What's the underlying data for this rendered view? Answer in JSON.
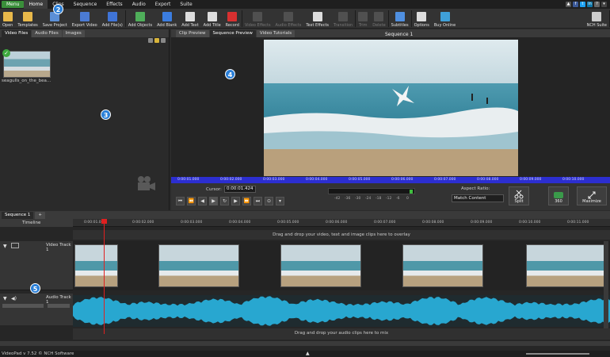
{
  "menubar": {
    "menu_label": "Menu",
    "tabs": [
      "Home",
      "Clips",
      "Sequence",
      "Effects",
      "Audio",
      "Export",
      "Suite"
    ],
    "active_tab": "Home"
  },
  "toolbar": {
    "items": [
      {
        "label": "Open",
        "icon": "folder-open-icon",
        "color": "#e8b84a",
        "enabled": true
      },
      {
        "label": "Templates",
        "icon": "folder-icon",
        "color": "#e8b84a",
        "enabled": true
      },
      {
        "label": "Save Project",
        "icon": "save-icon",
        "color": "#5b8fd6",
        "enabled": true
      },
      {
        "label": "Export Video",
        "icon": "export-icon",
        "color": "#4b7bd4",
        "enabled": true
      },
      {
        "label": "Add File(s)",
        "icon": "add-file-icon",
        "color": "#3f74d8",
        "enabled": true
      },
      {
        "label": "Add Objects",
        "icon": "add-objects-icon",
        "color": "#4fae5a",
        "enabled": true
      },
      {
        "label": "Add Blank",
        "icon": "add-blank-icon",
        "color": "#3b7de0",
        "enabled": true
      },
      {
        "label": "Add Text",
        "icon": "text-icon",
        "color": "#dddddd",
        "enabled": true
      },
      {
        "label": "Add Title",
        "icon": "title-icon",
        "color": "#dddddd",
        "enabled": true
      },
      {
        "label": "Record",
        "icon": "record-icon",
        "color": "#d83030",
        "enabled": true
      },
      {
        "label": "Video Effects",
        "icon": "video-effects-icon",
        "color": "#888888",
        "enabled": false
      },
      {
        "label": "Audio Effects",
        "icon": "audio-effects-icon",
        "color": "#888888",
        "enabled": false
      },
      {
        "label": "Text Effects",
        "icon": "text-effects-icon",
        "color": "#dddddd",
        "enabled": true
      },
      {
        "label": "Transition",
        "icon": "transition-icon",
        "color": "#888888",
        "enabled": false
      },
      {
        "label": "Trim",
        "icon": "trim-icon",
        "color": "#888888",
        "enabled": false
      },
      {
        "label": "Delete",
        "icon": "delete-icon",
        "color": "#888888",
        "enabled": false
      },
      {
        "label": "Subtitles",
        "icon": "subtitles-icon",
        "color": "#4f8fe0",
        "enabled": true
      },
      {
        "label": "Options",
        "icon": "options-icon",
        "color": "#dddddd",
        "enabled": true
      },
      {
        "label": "Buy Online",
        "icon": "buy-online-icon",
        "color": "#3fa0d8",
        "enabled": true
      },
      {
        "label": "NCH Suite",
        "icon": "nch-suite-icon",
        "color": "#cccccc",
        "enabled": true
      }
    ]
  },
  "bins": {
    "tabs": [
      "Video Files",
      "Audio Files",
      "Images"
    ],
    "active_tab": "Video Files",
    "clip_name": "seagulls_on_the_bea..."
  },
  "preview": {
    "tabs": [
      "Clip Preview",
      "Sequence Preview",
      "Video Tutorials"
    ],
    "active_tab": "Sequence Preview",
    "title": "Sequence 1",
    "ruler_ticks": [
      "0:00:01.000",
      "0:00:02.000",
      "0:00:03.000",
      "0:00:04.000",
      "0:00:05.000",
      "0:00:06.000",
      "0:00:07.000",
      "0:00:08.000",
      "0:00:09.000",
      "0:00:10.000"
    ],
    "cursor_label": "Cursor:",
    "cursor_time": "0:00:01.424",
    "meter_labels": [
      "-42",
      "-36",
      "-30",
      "-24",
      "-18",
      "-12",
      "-6",
      "0"
    ],
    "aspect_label": "Aspect Ratio:",
    "aspect_value": "Match Content",
    "split_label": "Split",
    "view_label": "360",
    "maximize_label": "Maximize"
  },
  "timeline": {
    "sequence_tab": "Sequence 1",
    "ruler_label": "Timeline",
    "ruler_ticks": [
      "0:00:01.000",
      "0:00:02.000",
      "0:00:03.000",
      "0:00:04.000",
      "0:00:05.000",
      "0:00:06.000",
      "0:00:07.000",
      "0:00:08.000",
      "0:00:09.000",
      "0:00:10.000",
      "0:00:11.000"
    ],
    "overlay_hint": "Drag and drop your video, text and image clips here to overlay",
    "video_track": "Video Track 1",
    "audio_track": "Audio Track 1",
    "audio_hint": "Drag and drop your audio clips here to mix"
  },
  "status": {
    "text": "VideoPad v 7.52 © NCH Software"
  },
  "badges": [
    "2",
    "3",
    "4",
    "5"
  ],
  "colors": {
    "accent_green": "#3a8f3a",
    "ruler_blue": "#2c2ed0",
    "playhead_red": "#e02020",
    "waveform": "#28a7d0",
    "badge_blue": "#2a7fd8"
  }
}
